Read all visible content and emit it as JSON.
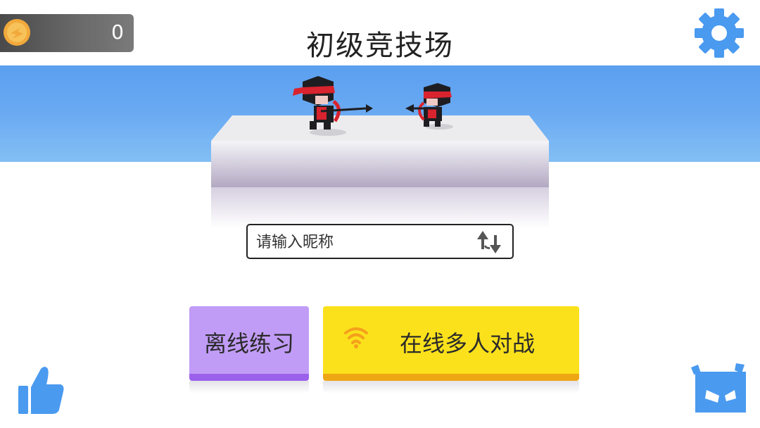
{
  "header": {
    "title": "初级竞技场",
    "coins": "0"
  },
  "nickname": {
    "placeholder": "请输入昵称"
  },
  "buttons": {
    "offline_label": "离线练习",
    "online_label": "在线多人对战"
  },
  "icons": {
    "coin": "coin-icon",
    "settings": "gear-icon",
    "random_name": "shuffle-arrows-icon",
    "wifi": "wifi-icon",
    "like": "thumbs-up-icon",
    "ninja_face": "ninja-face-icon"
  },
  "colors": {
    "sky": "#6aaaf2",
    "settings_icon": "#4a9af0",
    "offline_button": "#c19cf6",
    "online_button": "#fbe11c",
    "wifi_icon": "#f4a01c",
    "ninja_headband": "#d9232e"
  }
}
